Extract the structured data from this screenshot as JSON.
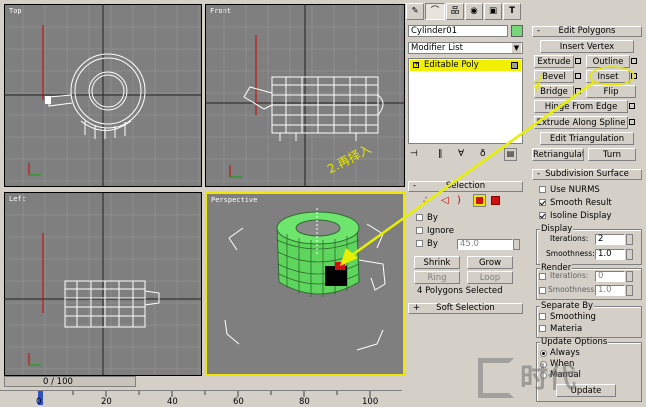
{
  "viewports": {
    "top": {
      "label": "Top"
    },
    "front": {
      "label": "Front"
    },
    "left": {
      "label": "Left"
    },
    "perspective": {
      "label": "Perspective"
    }
  },
  "timeline": {
    "frame_counter": "0 / 100",
    "ticks": [
      "0",
      "20",
      "40",
      "60",
      "80",
      "100"
    ]
  },
  "modify_panel": {
    "object_name": "Cylinder01",
    "modifier_list_label": "Modifier List",
    "stack_item": "Editable Poly"
  },
  "selection_rollout": {
    "title": "Selection",
    "by_vertex_label": "By",
    "ignore_label": "Ignore",
    "by_angle_label": "By",
    "angle_value": "45.0",
    "shrink_label": "Shrink",
    "grow_label": "Grow",
    "ring_label": "Ring",
    "loop_label": "Loop",
    "status": "4 Polygons Selected"
  },
  "soft_selection_rollout": {
    "title": "Soft Selection"
  },
  "edit_polygons": {
    "title": "Edit Polygons",
    "insert_vertex": "Insert Vertex",
    "extrude": "Extrude",
    "outline": "Outline",
    "bevel": "Bevel",
    "inset": "Inset",
    "bridge": "Bridge",
    "flip": "Flip",
    "hinge_from_edge": "Hinge From Edge",
    "extrude_along_spline": "Extrude Along Spline",
    "edit_triangulation": "Edit Triangulation",
    "retriangulate": "Retriangulate",
    "turn": "Turn"
  },
  "subdivision_surface": {
    "title": "Subdivision Surface",
    "use_nurms": "Use NURMS",
    "smooth_result": "Smooth Result",
    "isoline_display": "Isoline Display",
    "display_group": "Display",
    "iterations_label": "Iterations:",
    "display_iterations": "2",
    "smoothness_label": "Smoothness:",
    "display_smoothness": "1.0",
    "render_group": "Render",
    "render_iterations": "0",
    "render_smoothness": "1.0",
    "separate_by_group": "Separate By",
    "smoothing": "Smoothing",
    "materia": "Materia",
    "update_options_group": "Update Options",
    "always": "Always",
    "when": "When",
    "manual": "Manual",
    "update": "Update"
  },
  "annotations": {
    "step1": "1.",
    "step2": "2.再择入"
  },
  "watermark": "时代",
  "colors": {
    "viewport_bg": "#7f7f7f",
    "active_border": "#f0e600",
    "wire_white": "#ffffff",
    "mesh_green": "#5aff5a",
    "arrow_yellow": "#e6f000",
    "stack_highlight": "#f0f000"
  }
}
